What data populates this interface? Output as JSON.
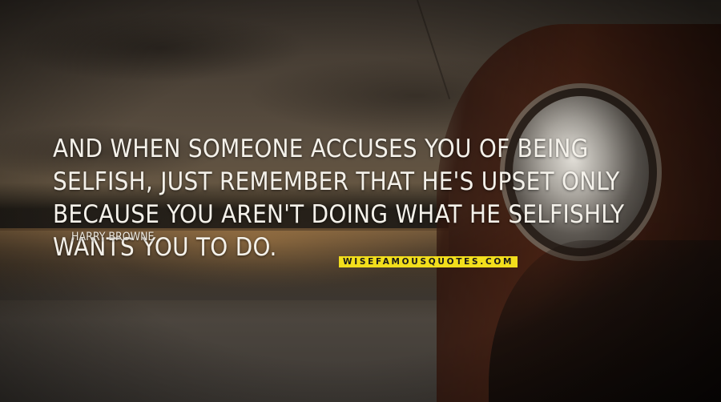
{
  "quote": {
    "text": "AND WHEN SOMEONE ACCUSES YOU OF BEING SELFISH, JUST REMEMBER THAT HE'S UPSET ONLY BECAUSE YOU AREN'T DOING WHAT HE SELFISHLY WANTS YOU TO DO.",
    "author": "HARRY BROWNE"
  },
  "watermark": {
    "text": "WISEFAMOUSQUOTES.COM",
    "background_color": "#f2de1c"
  }
}
